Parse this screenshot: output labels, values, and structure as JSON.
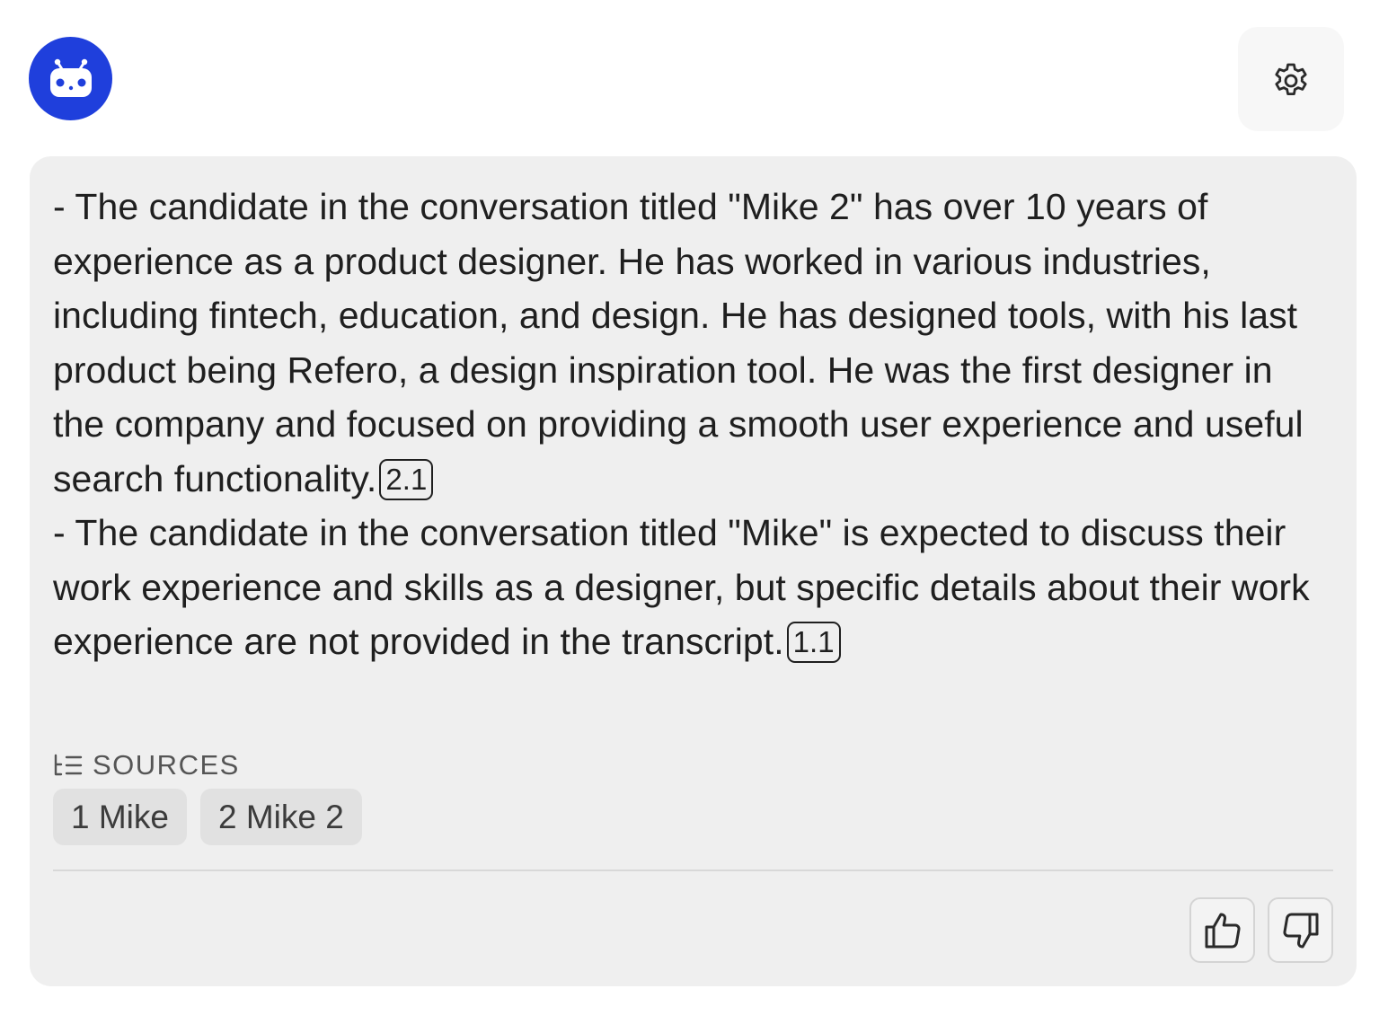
{
  "header": {
    "avatar_icon": "robot-bot-icon",
    "avatar_color": "#1f3fdc",
    "settings_icon": "gear-icon"
  },
  "message": {
    "paragraphs": [
      {
        "text": "- The candidate in the conversation titled \"Mike 2\" has over 10 years of experience as a product designer. He has worked in various industries, including fintech, education, and design. He has designed tools, with his last product being Refero, a design inspiration tool. He was the first designer in the company and focused on providing a smooth user experience and useful search functionality.",
        "citation": "2.1"
      },
      {
        "text": "- The candidate in the conversation titled \"Mike\" is expected to discuss their work experience and skills as a designer, but specific details about their work experience are not provided in the transcript.",
        "citation": "1.1"
      }
    ]
  },
  "sources": {
    "heading": "SOURCES",
    "icon": "list-icon",
    "items": [
      "1 Mike",
      "2 Mike 2"
    ]
  },
  "feedback": {
    "like_icon": "thumbs-up-icon",
    "dislike_icon": "thumbs-down-icon"
  }
}
